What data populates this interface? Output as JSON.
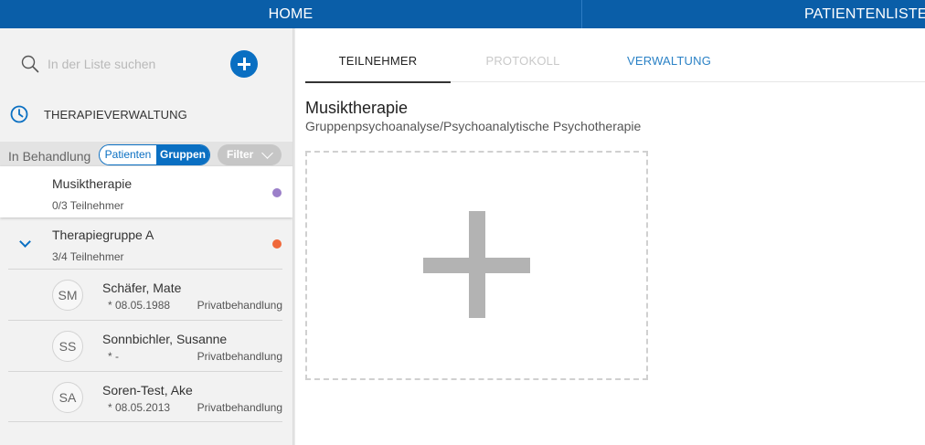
{
  "topbar": {
    "home_label": "HOME",
    "patients_label": "PATIENTENLISTE",
    "background": "#0a5ea8"
  },
  "sidebar": {
    "search": {
      "placeholder": "In der Liste suchen",
      "value": ""
    },
    "section_title": "THERAPIEVERWALTUNG",
    "filter_caption": "In Behandlung",
    "segment": {
      "patients_label": "Patienten",
      "groups_label": "Gruppen",
      "selected": "Gruppen"
    },
    "filter_label": "Filter",
    "groups": [
      {
        "name": "Musiktherapie",
        "count": "0/3 Teilnehmer",
        "dot_color": "#9b7fc9",
        "selected": true
      },
      {
        "name": "Therapiegruppe A",
        "count": "3/4 Teilnehmer",
        "dot_color": "#f0683a",
        "expanded": true
      }
    ],
    "patients": [
      {
        "initials": "SM",
        "name": "Schäfer, Mate",
        "birth": "* 08.05.1988",
        "type": "Privatbehandlung"
      },
      {
        "initials": "SS",
        "name": "Sonnbichler, Susanne",
        "birth": "* -",
        "type": "Privatbehandlung"
      },
      {
        "initials": "SA",
        "name": "Soren-Test, Ake",
        "birth": "* 08.05.2013",
        "type": "Privatbehandlung"
      }
    ]
  },
  "main": {
    "tabs": [
      {
        "label": "TEILNEHMER",
        "state": "active"
      },
      {
        "label": "PROTOKOLL",
        "state": "disabled"
      },
      {
        "label": "VERWALTUNG",
        "state": "normal"
      }
    ],
    "title": "Musiktherapie",
    "subtitle": "Gruppenpsychoanalyse/Psychoanalytische Psychotherapie"
  },
  "colors": {
    "accent": "#0a6fc2",
    "sidebar_bg": "#f2f2f2",
    "plus_gray": "#b3b3b3"
  }
}
